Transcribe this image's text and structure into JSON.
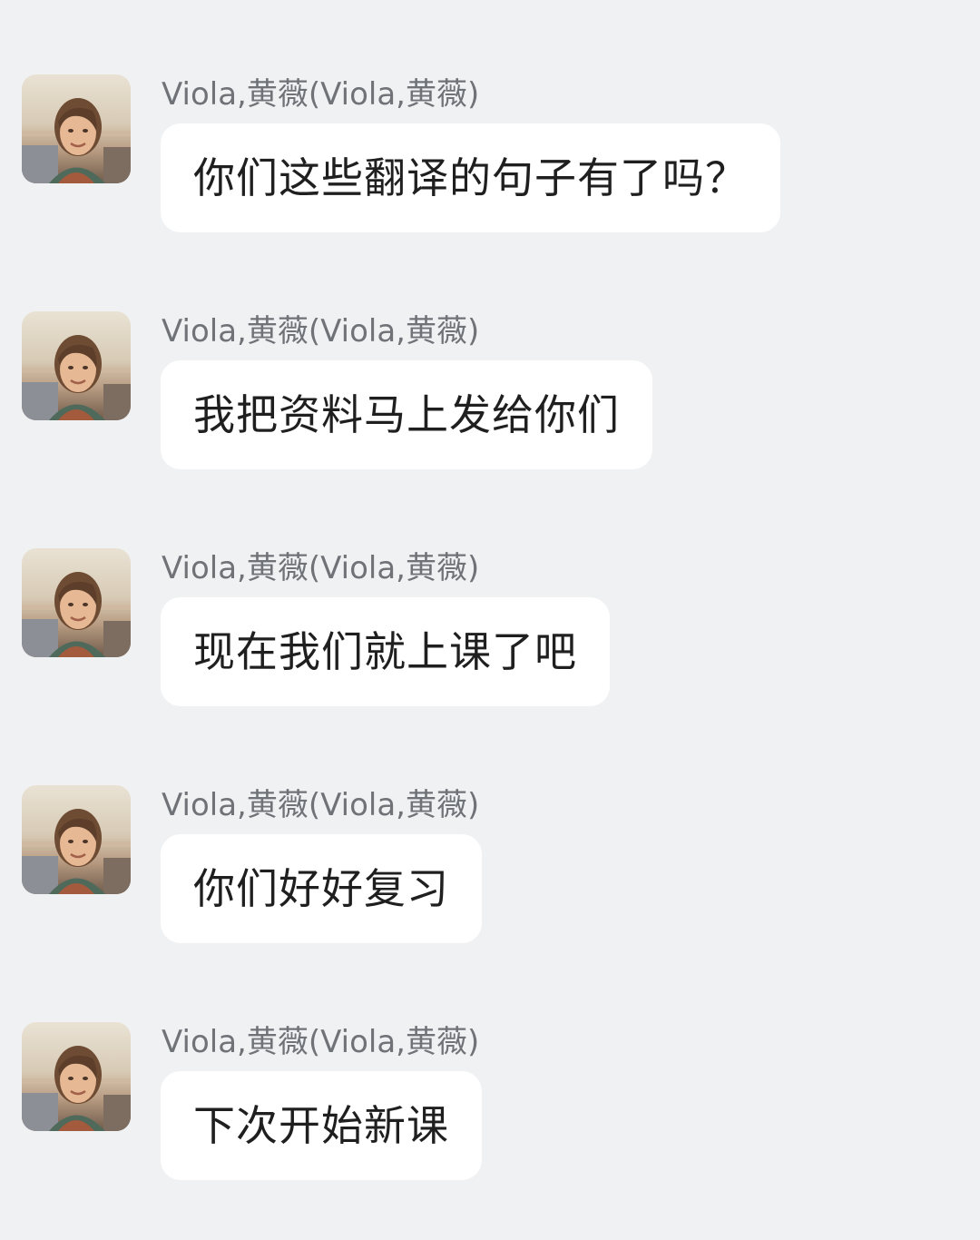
{
  "messages": [
    {
      "sender": "Viola,黄薇(Viola,黄薇)",
      "text": "你们这些翻译的句子有了吗？",
      "avatar_icon": "person-photo-icon"
    },
    {
      "sender": "Viola,黄薇(Viola,黄薇)",
      "text": "我把资料马上发给你们",
      "avatar_icon": "person-photo-icon"
    },
    {
      "sender": "Viola,黄薇(Viola,黄薇)",
      "text": "现在我们就上课了吧",
      "avatar_icon": "person-photo-icon"
    },
    {
      "sender": "Viola,黄薇(Viola,黄薇)",
      "text": "你们好好复习",
      "avatar_icon": "person-photo-icon"
    },
    {
      "sender": "Viola,黄薇(Viola,黄薇)",
      "text": "下次开始新课",
      "avatar_icon": "person-photo-icon"
    }
  ],
  "colors": {
    "background": "#f0f1f3",
    "bubble": "#ffffff",
    "sender_text": "#6f7378",
    "message_text": "#1f1f1f"
  }
}
